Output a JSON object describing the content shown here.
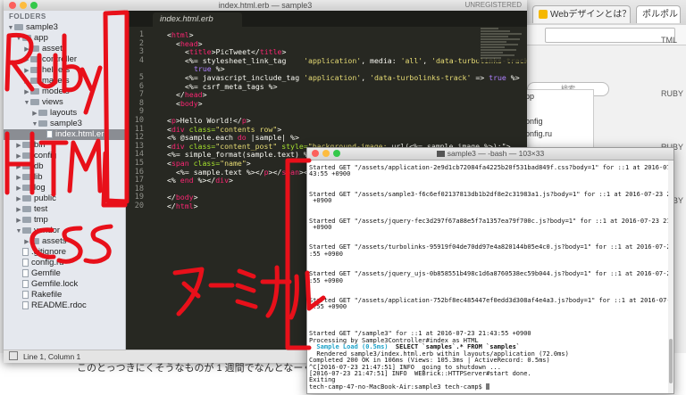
{
  "browser": {
    "tab_web": "Webデザインとは？W",
    "tab_user": "ポルポル",
    "search_placeholder": "検索"
  },
  "article": {
    "text": "このとっつきにくそうなものが 1 週間でなんとなーく分かるよう"
  },
  "finder": {
    "items": [
      "pp",
      "",
      "onfig",
      "onfig.ru",
      "",
      "ile",
      "lock"
    ],
    "right_labels": [
      "TML",
      "RUBY",
      "RUBY",
      "RUBY"
    ]
  },
  "sublime": {
    "title": "index.html.erb — sample3",
    "unregistered": "UNREGISTERED",
    "folders_label": "FOLDERS",
    "tab_label": "index.html.erb",
    "status": "Line 1, Column 1"
  },
  "tree": [
    {
      "label": "sample3",
      "type": "folder",
      "depth": 0,
      "open": true
    },
    {
      "label": "app",
      "type": "folder",
      "depth": 1,
      "open": true
    },
    {
      "label": "assets",
      "type": "folder",
      "depth": 2,
      "open": false
    },
    {
      "label": "controller",
      "type": "folder",
      "depth": 2,
      "open": false
    },
    {
      "label": "helpers",
      "type": "folder",
      "depth": 2,
      "open": false
    },
    {
      "label": "mailers",
      "type": "folder",
      "depth": 2,
      "open": false
    },
    {
      "label": "models",
      "type": "folder",
      "depth": 2,
      "open": false
    },
    {
      "label": "views",
      "type": "folder",
      "depth": 2,
      "open": true
    },
    {
      "label": "layouts",
      "type": "folder",
      "depth": 3,
      "open": false
    },
    {
      "label": "sample3",
      "type": "folder",
      "depth": 3,
      "open": true
    },
    {
      "label": "index.html.erb",
      "type": "file",
      "depth": 4,
      "selected": true
    },
    {
      "label": "bin",
      "type": "folder",
      "depth": 1,
      "open": false
    },
    {
      "label": "config",
      "type": "folder",
      "depth": 1,
      "open": false
    },
    {
      "label": "db",
      "type": "folder",
      "depth": 1,
      "open": false
    },
    {
      "label": "lib",
      "type": "folder",
      "depth": 1,
      "open": false
    },
    {
      "label": "log",
      "type": "folder",
      "depth": 1,
      "open": false
    },
    {
      "label": "public",
      "type": "folder",
      "depth": 1,
      "open": false
    },
    {
      "label": "test",
      "type": "folder",
      "depth": 1,
      "open": false
    },
    {
      "label": "tmp",
      "type": "folder",
      "depth": 1,
      "open": false
    },
    {
      "label": "vendor",
      "type": "folder",
      "depth": 1,
      "open": true
    },
    {
      "label": "assets",
      "type": "folder",
      "depth": 2,
      "open": false
    },
    {
      "label": ".gitignore",
      "type": "file",
      "depth": 1
    },
    {
      "label": "config.ru",
      "type": "file",
      "depth": 1
    },
    {
      "label": "Gemfile",
      "type": "file",
      "depth": 1
    },
    {
      "label": "Gemfile.lock",
      "type": "file",
      "depth": 1
    },
    {
      "label": "Rakefile",
      "type": "file",
      "depth": 1
    },
    {
      "label": "README.rdoc",
      "type": "file",
      "depth": 1
    }
  ],
  "code_lines": [
    {
      "n": "1",
      "segs": [
        [
          "<",
          "#f8f8f2"
        ],
        [
          "html",
          "#f92672"
        ],
        [
          ">",
          "#f8f8f2"
        ]
      ],
      "indent": 1
    },
    {
      "n": "2",
      "segs": [
        [
          "<",
          "#f8f8f2"
        ],
        [
          "head",
          "#f92672"
        ],
        [
          ">",
          "#f8f8f2"
        ]
      ],
      "indent": 2
    },
    {
      "n": "3",
      "segs": [
        [
          "<",
          "#f8f8f2"
        ],
        [
          "title",
          "#f92672"
        ],
        [
          ">PicTweet</",
          "#f8f8f2"
        ],
        [
          "title",
          "#f92672"
        ],
        [
          ">",
          "#f8f8f2"
        ]
      ],
      "indent": 3
    },
    {
      "n": "4",
      "segs": [
        [
          "<%= stylesheet_link_tag    ",
          "#f8f8f2"
        ],
        [
          "'application'",
          "#e6db74"
        ],
        [
          ", media: ",
          "#f8f8f2"
        ],
        [
          "'all'",
          "#e6db74"
        ],
        [
          ", ",
          "#f8f8f2"
        ],
        [
          "'data-turbolinks-track'",
          "#e6db74"
        ],
        [
          " =>",
          "#f8f8f2"
        ]
      ],
      "indent": 3
    },
    {
      "n": "",
      "segs": [
        [
          "true",
          "#ae81ff"
        ],
        [
          " %>",
          "#f8f8f2"
        ]
      ],
      "indent": 4
    },
    {
      "n": "5",
      "segs": [
        [
          "<%= javascript_include_tag ",
          "#f8f8f2"
        ],
        [
          "'application'",
          "#e6db74"
        ],
        [
          ", ",
          "#f8f8f2"
        ],
        [
          "'data-turbolinks-track'",
          "#e6db74"
        ],
        [
          " => ",
          "#f8f8f2"
        ],
        [
          "true",
          "#ae81ff"
        ],
        [
          " %>",
          "#f8f8f2"
        ]
      ],
      "indent": 3
    },
    {
      "n": "6",
      "segs": [
        [
          "<%= csrf_meta_tags %>",
          "#f8f8f2"
        ]
      ],
      "indent": 3
    },
    {
      "n": "7",
      "segs": [
        [
          "</",
          "#f8f8f2"
        ],
        [
          "head",
          "#f92672"
        ],
        [
          ">",
          "#f8f8f2"
        ]
      ],
      "indent": 2
    },
    {
      "n": "8",
      "segs": [
        [
          "<",
          "#f8f8f2"
        ],
        [
          "body",
          "#f92672"
        ],
        [
          ">",
          "#f8f8f2"
        ]
      ],
      "indent": 2
    },
    {
      "n": "9",
      "segs": [],
      "indent": 0
    },
    {
      "n": "10",
      "segs": [
        [
          "<",
          "#f8f8f2"
        ],
        [
          "p",
          "#f92672"
        ],
        [
          ">Hello World!</",
          "#f8f8f2"
        ],
        [
          "p",
          "#f92672"
        ],
        [
          ">",
          "#f8f8f2"
        ]
      ],
      "indent": 1
    },
    {
      "n": "11",
      "segs": [
        [
          "<",
          "#f8f8f2"
        ],
        [
          "div",
          "#f92672"
        ],
        [
          " class=",
          "#a6e22e"
        ],
        [
          "\"contents row\"",
          "#e6db74"
        ],
        [
          ">",
          "#f8f8f2"
        ]
      ],
      "indent": 1
    },
    {
      "n": "12",
      "segs": [
        [
          "<% @sample.each ",
          "#f8f8f2"
        ],
        [
          "do",
          "#f92672"
        ],
        [
          " |sample| %>",
          "#f8f8f2"
        ]
      ],
      "indent": 1
    },
    {
      "n": "13",
      "segs": [
        [
          "<",
          "#f8f8f2"
        ],
        [
          "div",
          "#f92672"
        ],
        [
          " class=",
          "#a6e22e"
        ],
        [
          "\"content_post\"",
          "#e6db74"
        ],
        [
          " style=",
          "#a6e22e"
        ],
        [
          "\"background-image: ",
          "#e6db74"
        ],
        [
          "url(<%= sample.image %>);\">",
          "#f8f8f2"
        ]
      ],
      "indent": 1
    },
    {
      "n": "14",
      "segs": [
        [
          "<%= simple_format(sample.text) %>",
          "#f8f8f2"
        ]
      ],
      "indent": 1
    },
    {
      "n": "15",
      "segs": [
        [
          "<",
          "#f8f8f2"
        ],
        [
          "span",
          "#f92672"
        ],
        [
          " class=",
          "#a6e22e"
        ],
        [
          "\"name\"",
          "#e6db74"
        ],
        [
          ">",
          "#f8f8f2"
        ]
      ],
      "indent": 1
    },
    {
      "n": "16",
      "segs": [
        [
          "<%= sample.text %></",
          "#f8f8f2"
        ],
        [
          "p",
          "#f92672"
        ],
        [
          "></",
          "#f8f8f2"
        ],
        [
          "span",
          "#f92672"
        ],
        [
          "></",
          "#f8f8f2"
        ],
        [
          "p",
          "#f92672"
        ],
        [
          ">",
          "#f8f8f2"
        ]
      ],
      "indent": 2
    },
    {
      "n": "17",
      "segs": [
        [
          "<% ",
          "#f8f8f2"
        ],
        [
          "end",
          "#f92672"
        ],
        [
          " %></",
          "#f8f8f2"
        ],
        [
          "div",
          "#f92672"
        ],
        [
          ">",
          "#f8f8f2"
        ]
      ],
      "indent": 1
    },
    {
      "n": "18",
      "segs": [],
      "indent": 0
    },
    {
      "n": "19",
      "segs": [
        [
          "</",
          "#f8f8f2"
        ],
        [
          "body",
          "#f92672"
        ],
        [
          ">",
          "#f8f8f2"
        ]
      ],
      "indent": 1
    },
    {
      "n": "20",
      "segs": [
        [
          "</",
          "#f8f8f2"
        ],
        [
          "html",
          "#f92672"
        ],
        [
          ">",
          "#f8f8f2"
        ]
      ],
      "indent": 1
    }
  ],
  "terminal": {
    "title": "sample3 — -bash — 103×33",
    "lines": [
      {
        "t": "Started GET \"/assets/application-2e9d1cb72084fa4225b20f531bad849f.css?body=1\" for ::1 at 2016-07-23 21:",
        "c": "#111"
      },
      {
        "t": "43:55 +0900",
        "c": "#111"
      },
      {
        "t": "",
        "c": "#111"
      },
      {
        "t": "",
        "c": "#111"
      },
      {
        "t": "Started GET \"/assets/sample3-f6c6ef02137813db1b2df8e2c31983a1.js?body=1\" for ::1 at 2016-07-23 21:43:55",
        "c": "#111"
      },
      {
        "t": " +0900",
        "c": "#111"
      },
      {
        "t": "",
        "c": "#111"
      },
      {
        "t": "",
        "c": "#111"
      },
      {
        "t": "Started GET \"/assets/jquery-fec3d297f67a88e5f7a1357ea79f700c.js?body=1\" for ::1 at 2016-07-23 21:43:55",
        "c": "#111"
      },
      {
        "t": " +0900",
        "c": "#111"
      },
      {
        "t": "",
        "c": "#111"
      },
      {
        "t": "",
        "c": "#111"
      },
      {
        "t": "Started GET \"/assets/turbolinks-95919f04de70dd97e4a820144b05e4c0.js?body=1\" for ::1 at 2016-07-23 21:43",
        "c": "#111"
      },
      {
        "t": ":55 +0900",
        "c": "#111"
      },
      {
        "t": "",
        "c": "#111"
      },
      {
        "t": "",
        "c": "#111"
      },
      {
        "t": "Started GET \"/assets/jquery_ujs-0b858551b498c1d6a8760538ec59b044.js?body=1\" for ::1 at 2016-07-23 21:43",
        "c": "#111"
      },
      {
        "t": ":55 +0900",
        "c": "#111"
      },
      {
        "t": "",
        "c": "#111"
      },
      {
        "t": "",
        "c": "#111"
      },
      {
        "t": "Started GET \"/assets/application-752bf8ec485447ef0edd3d308af4e4a3.js?body=1\" for ::1 at 2016-07-23 21:4",
        "c": "#111"
      },
      {
        "t": "3:55 +0900",
        "c": "#111"
      },
      {
        "t": "",
        "c": "#111"
      },
      {
        "t": "",
        "c": "#111"
      },
      {
        "t": "",
        "c": "#111"
      },
      {
        "t": "Started GET \"/sample3\" for ::1 at 2016-07-23 21:43:55 +0900",
        "c": "#111"
      },
      {
        "t": "Processing by Sample3Controller#index as HTML",
        "c": "#111"
      },
      {
        "t": "  Sample Load (0.5ms)  SELECT `samples`.* FROM `samples`",
        "c": "#111",
        "hl": "#1fa3c9"
      },
      {
        "t": "  Rendered sample3/index.html.erb within layouts/application (72.0ms)",
        "c": "#111"
      },
      {
        "t": "Completed 200 OK in 106ms (Views: 105.3ms | ActiveRecord: 0.5ms)",
        "c": "#111"
      },
      {
        "t": "^C[2016-07-23 21:47:51] INFO  going to shutdown ...",
        "c": "#111"
      },
      {
        "t": "[2016-07-23 21:47:51] INFO  WEBrick::HTTPServer#start done.",
        "c": "#111"
      },
      {
        "t": "Exiting",
        "c": "#111"
      },
      {
        "t": "tech-camp-47-no-MacBook-Air:sample3 tech-camp$ ",
        "c": "#111"
      }
    ]
  },
  "colors": {
    "marker_red": "#e8101a",
    "monokai_bg": "#272822",
    "sidebar_bg": "#e5e8ee"
  }
}
